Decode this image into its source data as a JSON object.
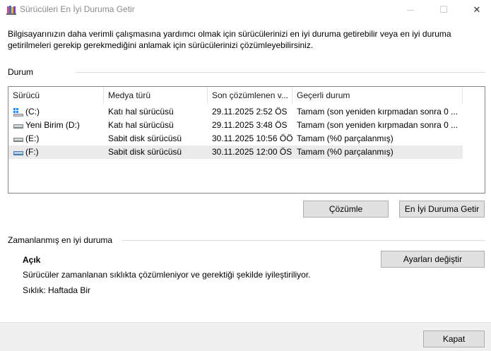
{
  "window": {
    "title": "Sürücüleri En İyi Duruma Getir",
    "controls": {
      "minimize": "—",
      "maximize": "☐",
      "close": "✕"
    }
  },
  "intro": "Bilgisayarınızın daha verimli çalışmasına yardımcı olmak için sürücülerinizi en iyi duruma getirebilir veya en iyi duruma getirilmeleri gerekip gerekmediğini anlamak için sürücülerinizi çözümleyebilirsiniz.",
  "status_section": {
    "label": "Durum",
    "columns": [
      "Sürücü",
      "Medya türü",
      "Son çözümlenen v...",
      "Geçerli durum"
    ],
    "rows": [
      {
        "drive": "(C:)",
        "icon": "windows-drive-icon",
        "media": "Katı hal sürücüsü",
        "last": "29.11.2025 2:52 ÖS",
        "status": "Tamam (son yeniden kırpmadan sonra 0 ..."
      },
      {
        "drive": "Yeni Birim (D:)",
        "icon": "drive-icon",
        "media": "Katı hal sürücüsü",
        "last": "29.11.2025 3:48 ÖS",
        "status": "Tamam (son yeniden kırpmadan sonra 0 ..."
      },
      {
        "drive": "(E:)",
        "icon": "drive-icon",
        "media": "Sabit disk sürücüsü",
        "last": "30.11.2025 10:56 ÖÖ",
        "status": "Tamam (%0 parçalanmış)"
      },
      {
        "drive": "(F:)",
        "icon": "drive-icon",
        "media": "Sabit disk sürücüsü",
        "last": "30.11.2025 12:00 ÖS",
        "status": "Tamam (%0 parçalanmış)"
      }
    ],
    "selected_row": 3,
    "analyze_button": "Çözümle",
    "optimize_button": "En İyi Duruma Getir"
  },
  "schedule_section": {
    "label": "Zamanlanmış en iyi duruma",
    "state": "Açık",
    "description": "Sürücüler zamanlanan sıklıkta çözümleniyor ve gerektiği şekilde iyileştiriliyor.",
    "frequency": "Sıklık: Haftada Bir",
    "change_settings_button": "Ayarları değiştir"
  },
  "footer": {
    "close_button": "Kapat"
  },
  "colors": {
    "window_bg": "#ffffff",
    "button_bg": "#e1e1e1",
    "footer_bg": "#f0f0f0",
    "selection_bg": "#ebebeb"
  }
}
